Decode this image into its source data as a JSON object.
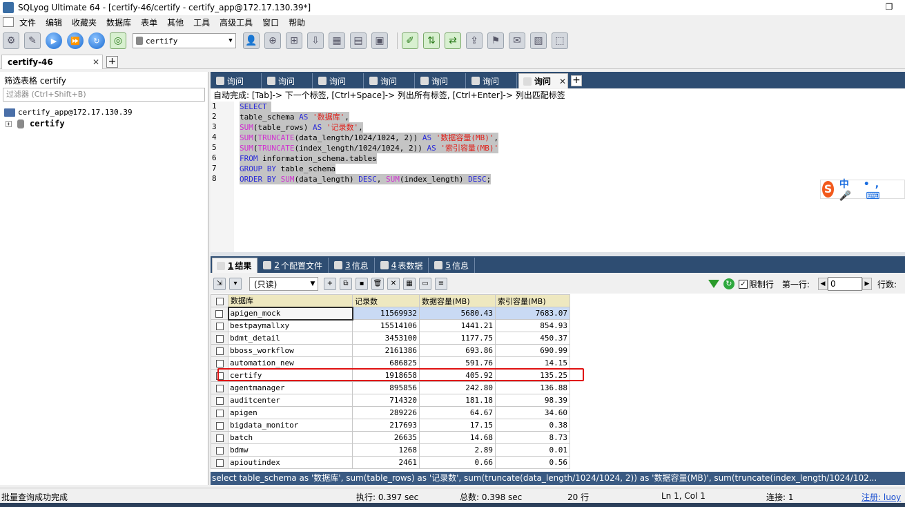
{
  "window": {
    "title": "SQLyog Ultimate 64 - [certify-46/certify - certify_app@172.17.130.39*]",
    "restore_glyph": "❐"
  },
  "menu": [
    "文件",
    "编辑",
    "收藏夹",
    "数据库",
    "表单",
    "其他",
    "工具",
    "高级工具",
    "窗口",
    "帮助"
  ],
  "toolbar": {
    "database_selector": "certify"
  },
  "connection_tab": {
    "label": "certify-46",
    "close": "✕",
    "add": "+"
  },
  "object_browser": {
    "filter_title": "筛选表格 certify",
    "filter_placeholder": "过滤器 (Ctrl+Shift+B)",
    "connection": "certify_app@172.17.130.39",
    "database": "certify"
  },
  "query_tabs": {
    "labels": [
      "询问",
      "询问",
      "询问",
      "询问",
      "询问",
      "询问",
      "询问"
    ],
    "close": "✕",
    "add": "+"
  },
  "autocomplete_hint": "自动完成: [Tab]-> 下一个标签, [Ctrl+Space]-> 列出所有标签, [Ctrl+Enter]-> 列出匹配标签",
  "editor": {
    "line_numbers": [
      "1",
      "2",
      "3",
      "4",
      "5",
      "6",
      "7",
      "8"
    ]
  },
  "ime": {
    "logo": "S",
    "text": "中 •, 🎤 ⌨"
  },
  "result_tabs": [
    {
      "num": "1",
      "label": "结果"
    },
    {
      "num": "2",
      "label": "个配置文件"
    },
    {
      "num": "3",
      "label": "信息"
    },
    {
      "num": "4",
      "label": "表数据"
    },
    {
      "num": "5",
      "label": "信息"
    }
  ],
  "result_toolbar": {
    "mode": "(只读)",
    "limit_label": "限制行",
    "first_row_label": "第一行:",
    "first_row_value": "0",
    "rows_label": "行数:"
  },
  "result_columns": [
    "数据库",
    "记录数",
    "数据容量(MB)",
    "索引容量(MB)"
  ],
  "result_rows": [
    [
      "apigen_mock",
      "11569932",
      "5680.43",
      "7683.07"
    ],
    [
      "bestpaymallxy",
      "15514106",
      "1441.21",
      "854.93"
    ],
    [
      "bdmt_detail",
      "3453100",
      "1177.75",
      "450.37"
    ],
    [
      "bboss_workflow",
      "2161386",
      "693.86",
      "690.99"
    ],
    [
      "automation_new",
      "686825",
      "591.76",
      "14.15"
    ],
    [
      "certify",
      "1918658",
      "405.92",
      "135.25"
    ],
    [
      "agentmanager",
      "895856",
      "242.80",
      "136.88"
    ],
    [
      "auditcenter",
      "714320",
      "181.18",
      "98.39"
    ],
    [
      "apigen",
      "289226",
      "64.67",
      "34.60"
    ],
    [
      "bigdata_monitor",
      "217693",
      "17.15",
      "0.38"
    ],
    [
      "batch",
      "26635",
      "14.68",
      "8.73"
    ],
    [
      "bdmw",
      "1268",
      "2.89",
      "0.01"
    ],
    [
      "apioutindex",
      "2461",
      "0.66",
      "0.56"
    ]
  ],
  "sql_strip": "select table_schema as '数据库', sum(table_rows) as '记录数', sum(truncate(data_length/1024/1024, 2)) as '数据容量(MB)', sum(truncate(index_length/1024/102...",
  "status": {
    "message": "批量查询成功完成",
    "exec_time": "执行: 0.397 sec",
    "total_time": "总数: 0.398 sec",
    "rows": "20 行",
    "cursor": "Ln 1, Col 1",
    "connections": "连接: 1",
    "register": "注册: luoy"
  }
}
